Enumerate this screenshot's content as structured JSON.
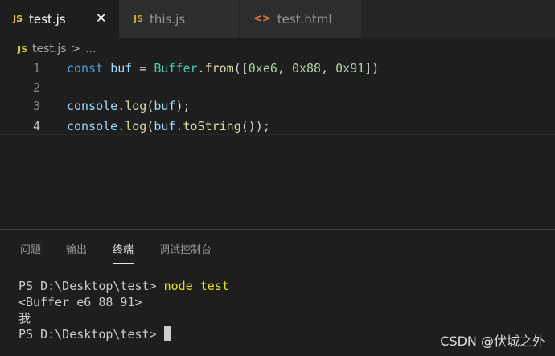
{
  "tabs": [
    {
      "icon": "JS",
      "label": "test.js",
      "close": "✕"
    },
    {
      "icon": "JS",
      "label": "this.js"
    },
    {
      "icon": "<>",
      "label": "test.html"
    }
  ],
  "breadcrumb": {
    "icon": "JS",
    "file": "test.js",
    "separator": ">",
    "more": "..."
  },
  "editor": {
    "line_numbers": [
      "1",
      "2",
      "3",
      "4"
    ],
    "line1": {
      "kw": "const",
      "var": "buf",
      "eq": " = ",
      "cls": "Buffer",
      "dot": ".",
      "fn": "from",
      "open": "([",
      "n1": "0xe6",
      "c1": ", ",
      "n2": "0x88",
      "c2": ", ",
      "n3": "0x91",
      "close": "])"
    },
    "line3": {
      "obj": "console",
      "dot": ".",
      "fn": "log",
      "open": "(",
      "arg": "buf",
      "close": ");"
    },
    "line4": {
      "obj": "console",
      "dot": ".",
      "fn": "log",
      "open": "(",
      "arg": "buf",
      "dot2": ".",
      "fn2": "toString",
      "close": "());"
    }
  },
  "panel": {
    "tabs": [
      "问题",
      "输出",
      "终端",
      "调试控制台"
    ],
    "active_tab": "终端"
  },
  "terminal": {
    "prompt": "PS D:\\Desktop\\test> ",
    "command": "node test",
    "output1": "<Buffer e6 88 91>",
    "output2": "我"
  },
  "watermark": "CSDN @伏城之外",
  "colors": {
    "keyword": "#569cd6",
    "variable": "#9cdcfe",
    "class": "#4ec9b0",
    "function": "#dcdcaa",
    "number": "#b5cea8",
    "command": "#e5e510"
  }
}
